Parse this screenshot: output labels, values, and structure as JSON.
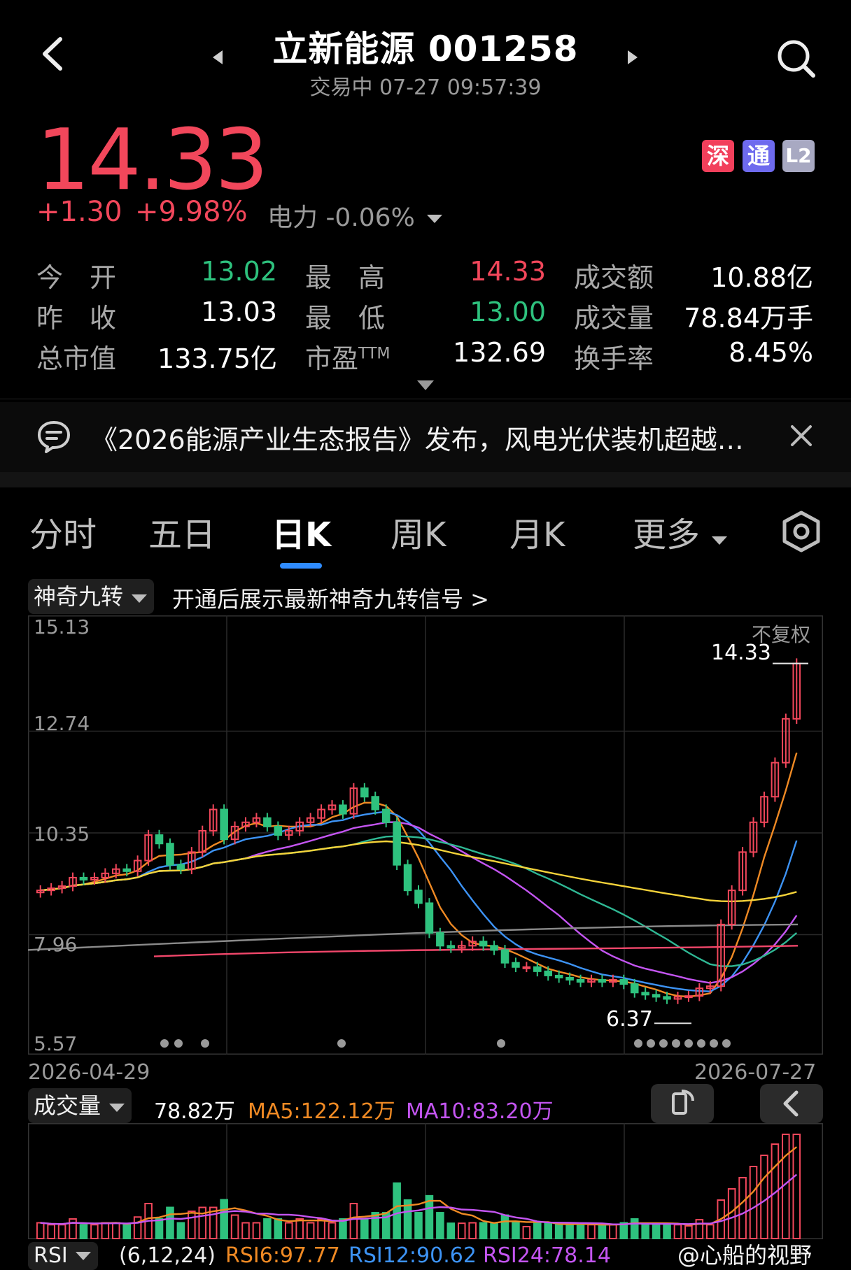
{
  "header": {
    "title": "立新能源 001258",
    "status": "交易中 07-27 09:57:39",
    "icons": {
      "back": "back-arrow-icon",
      "prev": "prev-stock-icon",
      "next": "next-stock-icon",
      "search": "search-icon"
    }
  },
  "quote": {
    "price": "14.33",
    "change": "+1.30",
    "change_pct": "+9.98%",
    "sector": "电力 -0.06%",
    "badges": {
      "sz": "深",
      "hk": "通",
      "l2": "L2"
    },
    "badge_colors": {
      "sz": "#f23f5b",
      "hk": "#6e6aee",
      "l2": "#a8a9c2"
    }
  },
  "stats": {
    "open_label": "今　开",
    "open": "13.02",
    "high_label": "最　高",
    "high": "14.33",
    "amount_label": "成交额",
    "amount": "10.88亿",
    "prev_label": "昨　收",
    "prev": "13.03",
    "low_label": "最　低",
    "low": "13.00",
    "volume_label": "成交量",
    "volume": "78.84万手",
    "mcap_label": "总市值",
    "mcap": "133.75亿",
    "pe_label": "市盈",
    "pe_sup": "TTM",
    "pe": "132.69",
    "turnover_label": "换手率",
    "turnover": "8.45%"
  },
  "news": {
    "text": "《2026能源产业生态报告》发布，风电光伏装机超越…"
  },
  "tabs": [
    "分时",
    "五日",
    "日K",
    "周K",
    "月K",
    "更多"
  ],
  "active_tab": "日K",
  "indicator": {
    "name": "神奇九转",
    "promo": "开通后展示最新神奇九转信号 >"
  },
  "price_chart": {
    "y_ticks": [
      "15.13",
      "12.74",
      "10.35",
      "7.96",
      "5.57"
    ],
    "adjust": "不复权",
    "high_mark": "14.33",
    "low_mark": "6.37",
    "start_date": "2026-04-29",
    "end_date": "2026-07-27"
  },
  "volume": {
    "label": "成交量",
    "value": "78.82万",
    "ma5": "MA5:122.12万",
    "ma10": "MA10:83.20万"
  },
  "rsi": {
    "label": "RSI",
    "params": "(6,12,24)",
    "rsi6": "RSI6:97.77",
    "rsi12": "RSI12:90.62",
    "rsi24": "RSI24:78.14"
  },
  "watermark": "@心船的视野",
  "colors": {
    "up": "#f2475b",
    "down": "#2ec27e",
    "accent": "#2f8cff"
  },
  "chart_data": {
    "type": "candlestick",
    "ylim": [
      5.57,
      15.13
    ],
    "closes": [
      9.0,
      9.05,
      9.1,
      9.3,
      9.25,
      9.3,
      9.4,
      9.5,
      9.45,
      9.7,
      10.3,
      10.1,
      9.6,
      9.5,
      9.9,
      10.4,
      10.9,
      10.2,
      10.5,
      10.6,
      10.7,
      10.5,
      10.3,
      10.4,
      10.6,
      10.7,
      10.9,
      11.0,
      10.8,
      11.4,
      11.2,
      10.9,
      10.6,
      9.6,
      9.0,
      8.7,
      8.0,
      7.7,
      7.65,
      7.7,
      7.8,
      7.7,
      7.6,
      7.3,
      7.2,
      7.2,
      7.1,
      7.0,
      6.95,
      6.9,
      6.85,
      6.9,
      6.85,
      6.9,
      6.8,
      6.6,
      6.55,
      6.5,
      6.45,
      6.5,
      6.52,
      6.7,
      6.75,
      8.2,
      9.0,
      9.9,
      10.6,
      11.2,
      12.0,
      13.03,
      14.33
    ],
    "volume_ma5": "122.12万",
    "volume_ma10": "83.20万"
  }
}
